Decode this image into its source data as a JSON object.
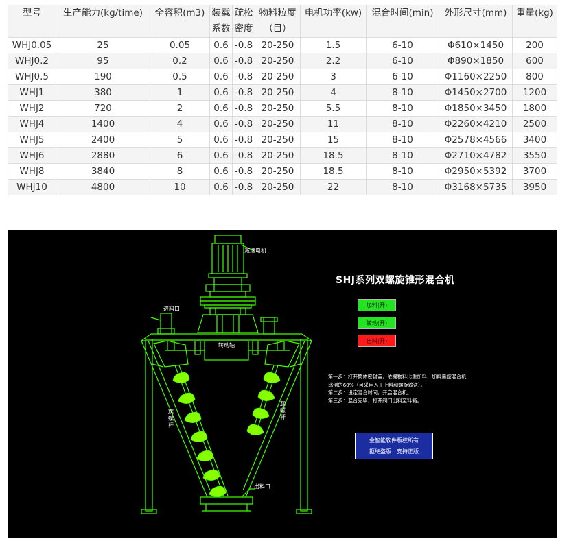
{
  "table": {
    "headers": [
      [
        "型号"
      ],
      [
        "生产能力(kg/time)"
      ],
      [
        "全容积(m3)"
      ],
      [
        "装载",
        "系数"
      ],
      [
        "疏松",
        "密度"
      ],
      [
        "物料粒度",
        "（目）"
      ],
      [
        "电机功率(kw)"
      ],
      [
        "混合时间(min)"
      ],
      [
        "外形尺寸(mm)"
      ],
      [
        "重量(kg)"
      ]
    ],
    "rows": [
      [
        "WHJ0.05",
        "25",
        "0.05",
        "0.6",
        "-0.8",
        "20-250",
        "1.5",
        "6-10",
        "Φ610×1450",
        "200"
      ],
      [
        "WHJ0.2",
        "95",
        "0.2",
        "0.6",
        "-0.8",
        "20-250",
        "2.2",
        "6-10",
        "Φ890×1850",
        "600"
      ],
      [
        "WHJ0.5",
        "190",
        "0.5",
        "0.6",
        "-0.8",
        "20-250",
        "3",
        "6-10",
        "Φ1160×2250",
        "800"
      ],
      [
        "WHJ1",
        "380",
        "1",
        "0.6",
        "-0.8",
        "20-250",
        "4",
        "8-10",
        "Φ1450×2700",
        "1200"
      ],
      [
        "WHJ2",
        "720",
        "2",
        "0.6",
        "-0.8",
        "20-250",
        "5.5",
        "8-10",
        "Φ1850×3450",
        "1800"
      ],
      [
        "WHJ4",
        "1400",
        "4",
        "0.6",
        "-0.8",
        "20-250",
        "11",
        "8-10",
        "Φ2260×4210",
        "2500"
      ],
      [
        "WHJ5",
        "2400",
        "5",
        "0.6",
        "-0.8",
        "20-250",
        "15",
        "8-10",
        "Φ2578×4566",
        "3400"
      ],
      [
        "WHJ6",
        "2880",
        "6",
        "0.6",
        "-0.8",
        "20-250",
        "18.5",
        "8-10",
        "Φ2710×4782",
        "3550"
      ],
      [
        "WHJ8",
        "3840",
        "8",
        "0.6",
        "-0.8",
        "20-250",
        "18.5",
        "8-10",
        "Φ2950×5392",
        "3700"
      ],
      [
        "WHJ10",
        "4800",
        "10",
        "0.6",
        "-0.8",
        "20-250",
        "22",
        "8-10",
        "Φ3168×5735",
        "3950"
      ]
    ]
  },
  "diagram": {
    "title": "SHJ系列双螺旋锥形混合机",
    "labels": {
      "motor": "减速电机",
      "inlet": "进料口",
      "shaft": "转动轴",
      "screw_left": [
        "旋",
        "螺",
        "杆"
      ],
      "screw_right": [
        "旋",
        "螺",
        "杆"
      ],
      "outlet": "出料口"
    },
    "buttons": {
      "feed": "加料(开)",
      "rotate": "转动(开)",
      "discharge": "出料(开)"
    },
    "steps": [
      "第一步：打开筒体密封盖，依据物料比重加料，加料量按混合机",
      "比例的60%（可采用人工上料和螺旋输送）。",
      "第二步：设定混合时间，开启混合机。",
      "第三步：混合完毕，打开阀门出料至料箱。"
    ],
    "copyright": {
      "line1": "金智能软件版权所有",
      "line2": "拒绝盗版　支持正版"
    },
    "colors": {
      "outline": "#44ff00",
      "screw": "#88ff00",
      "background": "#000000",
      "button_green": "#23e323",
      "button_red": "#ff1a1a",
      "copyright_bg": "#1b2da0"
    }
  }
}
